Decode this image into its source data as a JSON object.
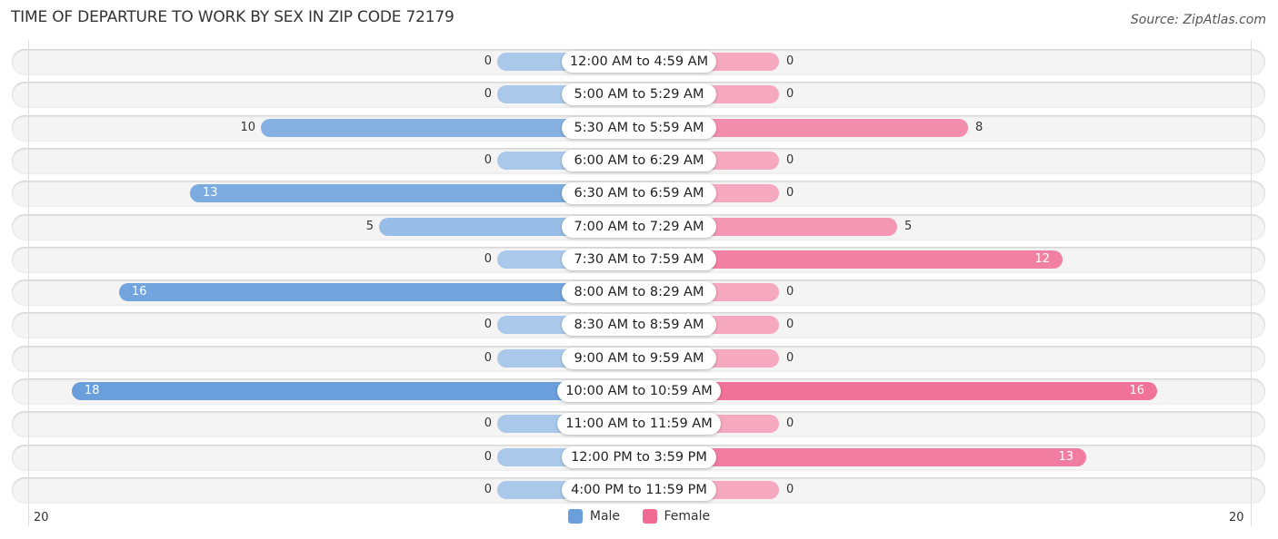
{
  "header": {
    "title": "TIME OF DEPARTURE TO WORK BY SEX IN ZIP CODE 72179",
    "source": "Source: ZipAtlas.com"
  },
  "colors": {
    "male_strong": "#6a9fdb",
    "male_light": "#a9c8ea",
    "female_strong": "#f06b94",
    "female_light": "#f5a8c0"
  },
  "chart_data": {
    "type": "bar",
    "orientation": "horizontal-diverging",
    "title": "TIME OF DEPARTURE TO WORK BY SEX IN ZIP CODE 72179",
    "categories": [
      "12:00 AM to 4:59 AM",
      "5:00 AM to 5:29 AM",
      "5:30 AM to 5:59 AM",
      "6:00 AM to 6:29 AM",
      "6:30 AM to 6:59 AM",
      "7:00 AM to 7:29 AM",
      "7:30 AM to 7:59 AM",
      "8:00 AM to 8:29 AM",
      "8:30 AM to 8:59 AM",
      "9:00 AM to 9:59 AM",
      "10:00 AM to 10:59 AM",
      "11:00 AM to 11:59 AM",
      "12:00 PM to 3:59 PM",
      "4:00 PM to 11:59 PM"
    ],
    "series": [
      {
        "name": "Male",
        "values": [
          0,
          0,
          10,
          0,
          13,
          5,
          0,
          16,
          0,
          0,
          18,
          0,
          0,
          0
        ]
      },
      {
        "name": "Female",
        "values": [
          0,
          0,
          8,
          0,
          0,
          5,
          12,
          0,
          0,
          0,
          16,
          0,
          13,
          0
        ]
      }
    ],
    "axis": {
      "left_label": "20",
      "right_label": "20",
      "range": [
        0,
        20
      ]
    },
    "legend": {
      "position": "bottom-center",
      "entries": [
        "Male",
        "Female"
      ]
    },
    "xlabel": "",
    "ylabel": ""
  }
}
